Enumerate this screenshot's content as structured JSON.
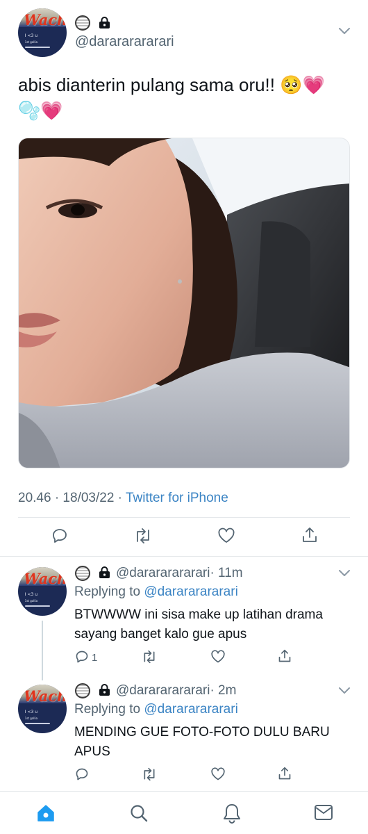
{
  "main_tweet": {
    "avatar_word": "Wach",
    "avatar_line1": "I <3 u",
    "avatar_line2": "1st gallia",
    "handle": "@darararararari",
    "text_line1": "abis dianterin pulang sama oru!! 🥺💗",
    "text_line2": "🫧💗",
    "image_alt": "selfie photo",
    "timestamp": "20.46 · 18/03/22 · ",
    "source": "Twitter for iPhone"
  },
  "replies": [
    {
      "avatar_word": "Wach",
      "handle": "@darararararari",
      "time": "· 11m",
      "replying_prefix": "Replying to ",
      "replying_handle": "@darararararari",
      "line1": "BTWWWW ini sisa make up latihan drama",
      "line2": "sayang banget kalo gue apus",
      "reply_count": "1"
    },
    {
      "avatar_word": "Wach",
      "handle": "@darararararari",
      "time": "· 2m",
      "replying_prefix": "Replying to ",
      "replying_handle": "@darararararari",
      "line1": "MENDING GUE FOTO-FOTO DULU BARU",
      "line2": "APUS",
      "reply_count": ""
    }
  ],
  "colors": {
    "accent": "#1d9bf0",
    "text": "#0f1419",
    "muted": "#536471",
    "heart": "#f0569a"
  },
  "icons": [
    "reply-icon",
    "retweet-icon",
    "like-icon",
    "share-icon",
    "home-icon",
    "search-icon",
    "notifications-icon",
    "messages-icon",
    "lock-icon",
    "chevron-down-icon"
  ]
}
